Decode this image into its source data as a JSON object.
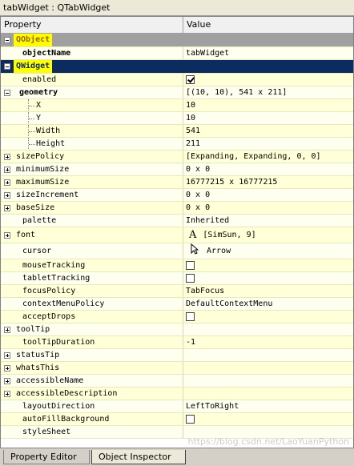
{
  "window": {
    "title": "tabWidget : QTabWidget"
  },
  "header": {
    "property": "Property",
    "value": "Value"
  },
  "groups": {
    "qobject": "QObject",
    "qwidget": "QWidget"
  },
  "rows": {
    "objectName": {
      "name": "objectName",
      "value": "tabWidget"
    },
    "enabled": {
      "name": "enabled",
      "checked": true
    },
    "geometry": {
      "name": "geometry",
      "value": "[(10, 10), 541 x 211]"
    },
    "x": {
      "name": "X",
      "value": "10"
    },
    "y": {
      "name": "Y",
      "value": "10"
    },
    "width": {
      "name": "Width",
      "value": "541"
    },
    "height": {
      "name": "Height",
      "value": "211"
    },
    "sizePolicy": {
      "name": "sizePolicy",
      "value": "[Expanding, Expanding, 0, 0]"
    },
    "minimumSize": {
      "name": "minimumSize",
      "value": "0 x 0"
    },
    "maximumSize": {
      "name": "maximumSize",
      "value": "16777215 x 16777215"
    },
    "sizeIncrement": {
      "name": "sizeIncrement",
      "value": "0 x 0"
    },
    "baseSize": {
      "name": "baseSize",
      "value": "0 x 0"
    },
    "palette": {
      "name": "palette",
      "value": "Inherited"
    },
    "font": {
      "name": "font",
      "icon": "A",
      "value": "[SimSun, 9]"
    },
    "cursor": {
      "name": "cursor",
      "value": "Arrow"
    },
    "mouseTracking": {
      "name": "mouseTracking",
      "checked": false
    },
    "tabletTracking": {
      "name": "tabletTracking",
      "checked": false
    },
    "focusPolicy": {
      "name": "focusPolicy",
      "value": "TabFocus"
    },
    "contextMenuPolicy": {
      "name": "contextMenuPolicy",
      "value": "DefaultContextMenu"
    },
    "acceptDrops": {
      "name": "acceptDrops",
      "checked": false
    },
    "toolTip": {
      "name": "toolTip",
      "value": ""
    },
    "toolTipDuration": {
      "name": "toolTipDuration",
      "value": "-1"
    },
    "statusTip": {
      "name": "statusTip",
      "value": ""
    },
    "whatsThis": {
      "name": "whatsThis",
      "value": ""
    },
    "accessibleName": {
      "name": "accessibleName",
      "value": ""
    },
    "accessibleDescription": {
      "name": "accessibleDescription",
      "value": ""
    },
    "layoutDirection": {
      "name": "layoutDirection",
      "value": "LeftToRight"
    },
    "autoFillBackground": {
      "name": "autoFillBackground",
      "checked": false
    },
    "styleSheet": {
      "name": "styleSheet",
      "value": ""
    }
  },
  "tabs": {
    "property_editor": "Property Editor",
    "object_inspector": "Object Inspector"
  },
  "watermark": "https://blog.csdn.net/LaoYuanPython",
  "colors": {
    "group_qobject_bg": "#a0a0a0",
    "group_qwidget_bg": "#0c2b5e",
    "highlight": "#ffff00",
    "row_a": "#ffffd8",
    "row_b": "#ffffef"
  }
}
